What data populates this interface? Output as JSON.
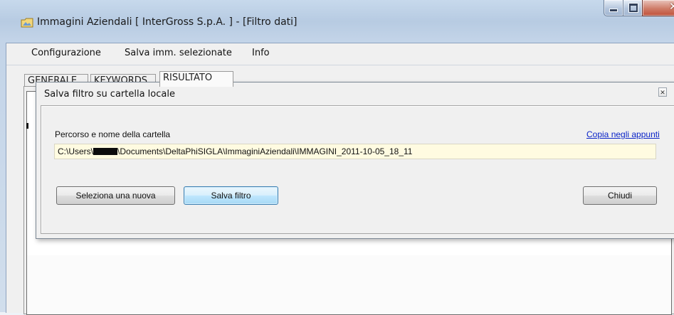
{
  "window": {
    "title": "Immagini Aziendali [ InterGross S.p.A. ] - [Filtro dati]",
    "app_icon": "folder-image-icon"
  },
  "menu": {
    "items": [
      "Configurazione",
      "Salva imm. selezionate",
      "Info"
    ]
  },
  "tabs": {
    "items": [
      "GENERALE",
      "KEYWORDS",
      "RISULTATO"
    ],
    "active": "RISULTATO"
  },
  "dialog": {
    "title": "Salva filtro su cartella locale",
    "path_label": "Percorso e nome della cartella",
    "copy_link": "Copia negli appunti",
    "path_prefix": "C:\\Users\\",
    "path_suffix": "\\Documents\\DeltaPhiSIGLA\\ImmaginiAziendali\\IMMAGINI_2011-10-05_18_11",
    "buttons": {
      "select_new": "Seleziona una nuova",
      "save_filter": "Salva filtro",
      "close": "Chiudi"
    }
  },
  "colors": {
    "link": "#0a24c8",
    "path_field_bg": "#fffbe1",
    "primary_button_border": "#3c7fb1"
  }
}
